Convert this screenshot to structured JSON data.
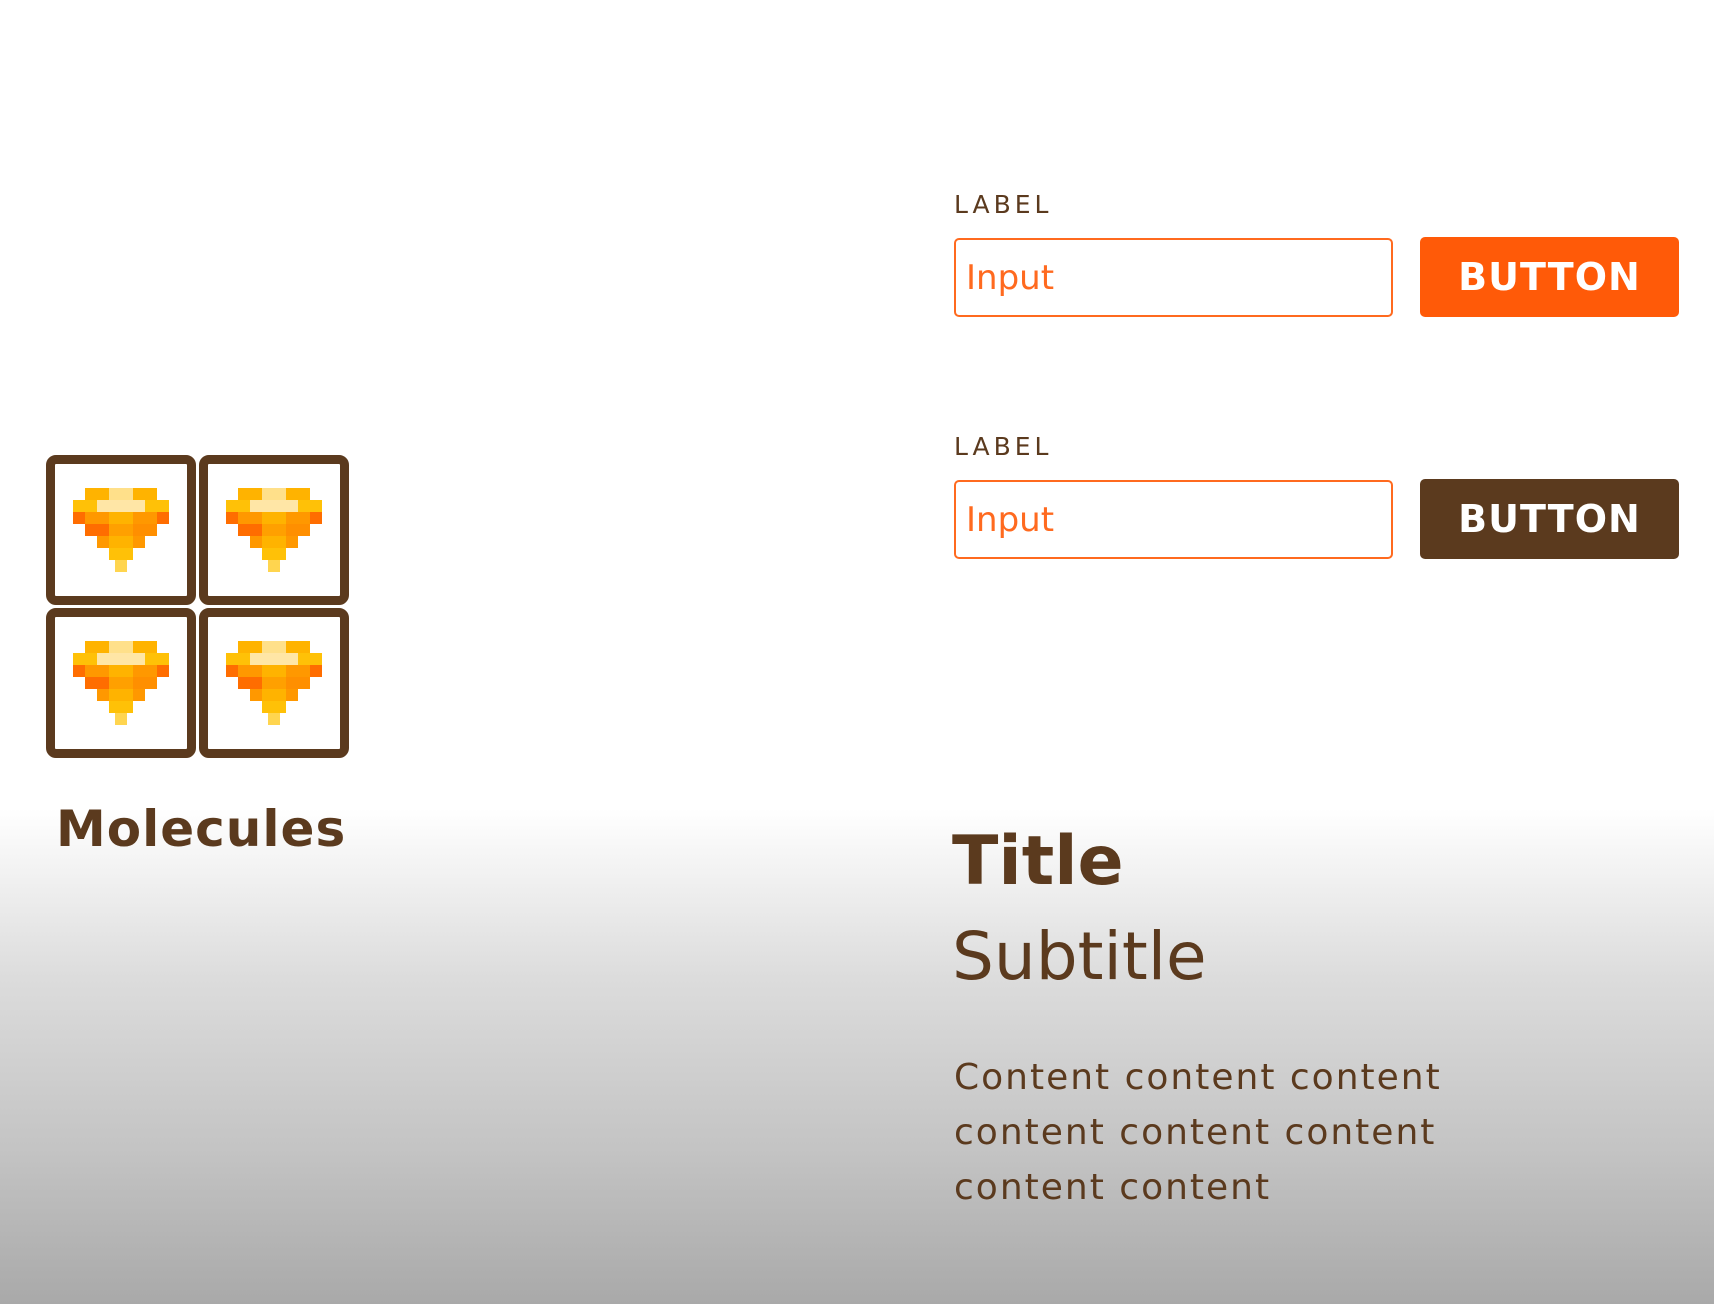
{
  "molecules": {
    "title": "Molecules",
    "icon": "sketch-diamond-icon",
    "tile_count": 4
  },
  "form_rows": [
    {
      "label": "LABEL",
      "input_placeholder": "Input",
      "button_label": "BUTTON",
      "button_color": "#ff5a08"
    },
    {
      "label": "LABEL",
      "input_placeholder": "Input",
      "button_label": "BUTTON",
      "button_color": "#5b3a1e"
    }
  ],
  "card": {
    "title": "Title",
    "subtitle": "Subtitle",
    "content": "Content content content content content content content content"
  },
  "colors": {
    "brown": "#5b3a1e",
    "orange": "#ff5a08",
    "input_border": "#ff6a1f"
  }
}
